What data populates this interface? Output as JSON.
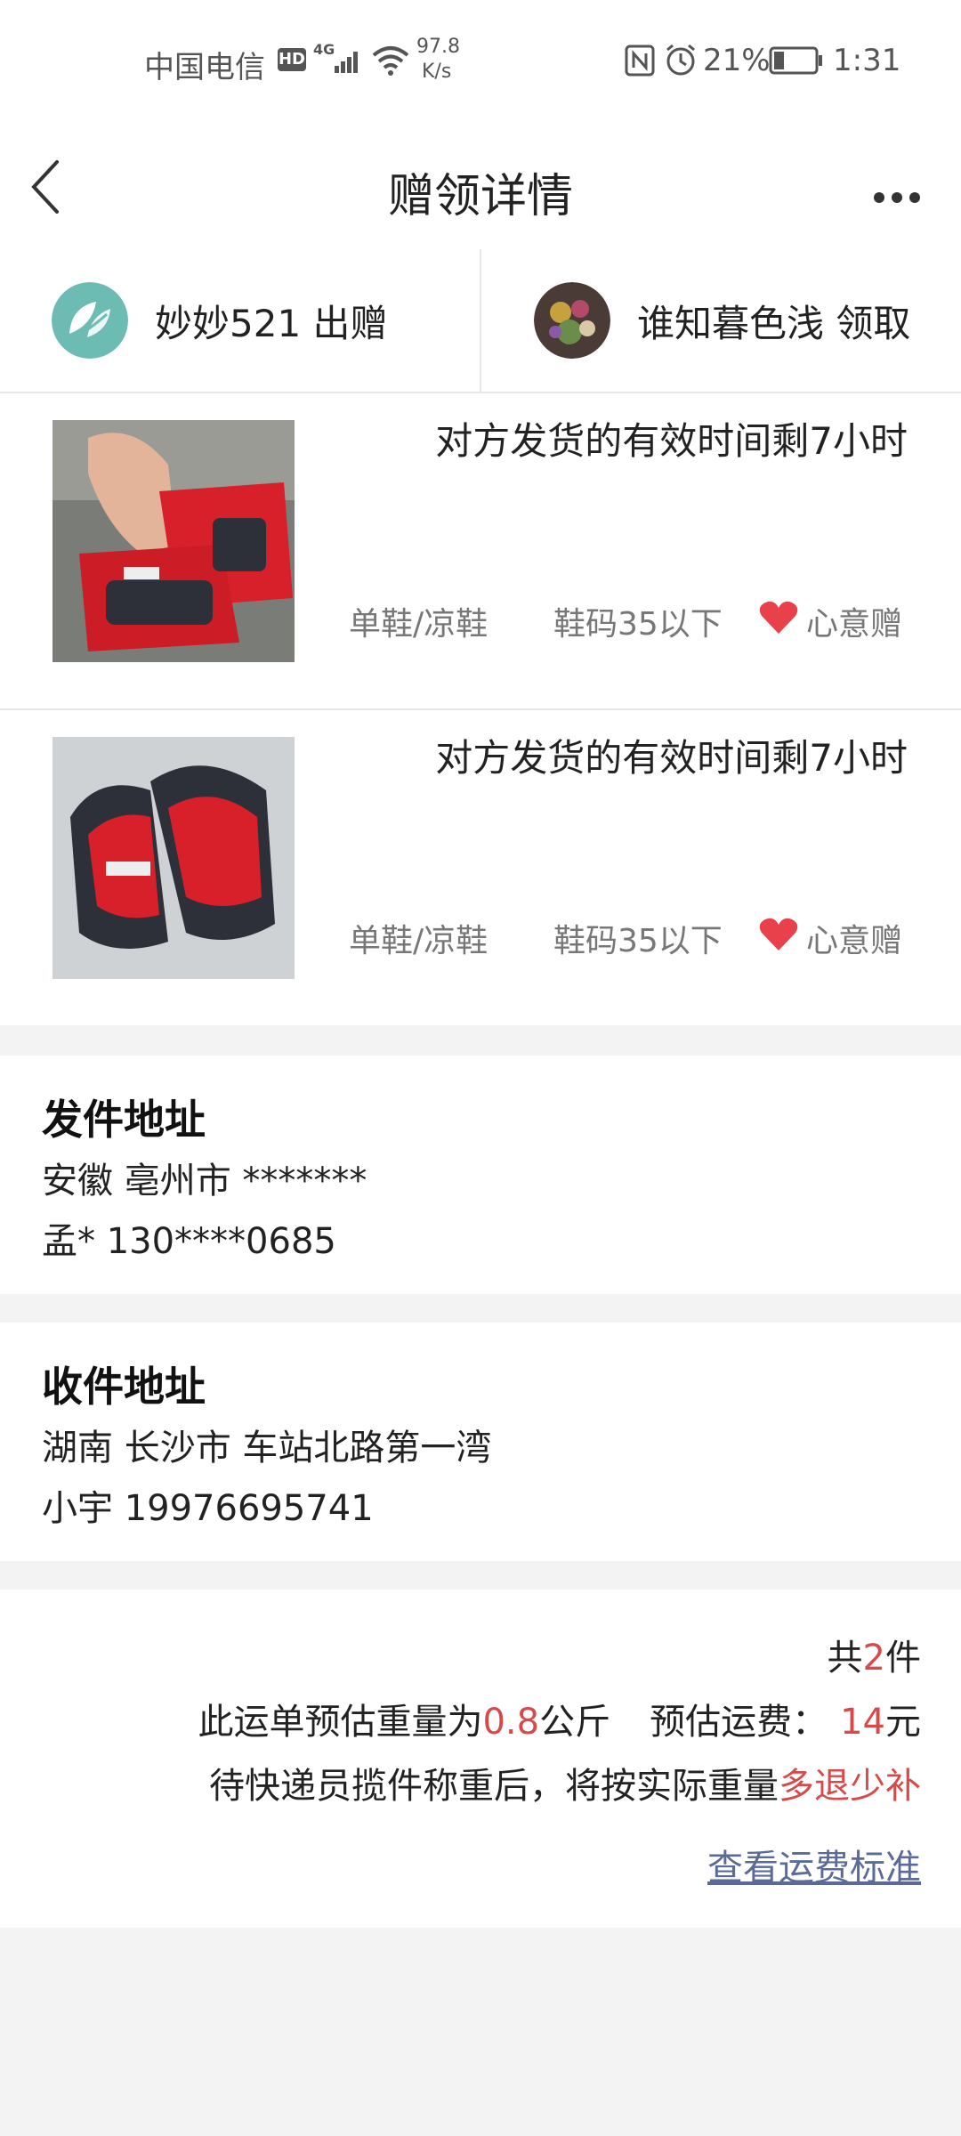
{
  "status_bar": {
    "carrier": "中国电信",
    "hd_badge": "HD",
    "network": "4G",
    "speed_value": "97.8",
    "speed_unit": "K/s",
    "battery_percent": "21%",
    "time": "1:31"
  },
  "header": {
    "title": "赠领详情"
  },
  "users": {
    "giver": {
      "name": "妙妙521",
      "action": "出赠",
      "label": "妙妙521 出赠"
    },
    "receiver": {
      "name": "谁知暮色浅",
      "action": "领取",
      "label": "谁知暮色浅 领取"
    }
  },
  "items": [
    {
      "deadline": "对方发货的有效时间剩7小时",
      "category": "单鞋/凉鞋",
      "size": "鞋码35以下",
      "tag": "心意赠"
    },
    {
      "deadline": "对方发货的有效时间剩7小时",
      "category": "单鞋/凉鞋",
      "size": "鞋码35以下",
      "tag": "心意赠"
    }
  ],
  "sender_address": {
    "title": "发件地址",
    "line1": "安徽 亳州市 *******",
    "line2": "孟* 130****0685"
  },
  "receiver_address": {
    "title": "收件地址",
    "line1": "湖南 长沙市 车站北路第一湾",
    "line2": "小宇 19976695741"
  },
  "summary": {
    "count_prefix": "共",
    "count_value": "2",
    "count_suffix": "件",
    "weight_prefix": "此运单预估重量为",
    "weight_value": "0.8",
    "weight_unit": "公斤",
    "fee_prefix": "预估运费：",
    "fee_value": "14",
    "fee_unit": "元",
    "note_prefix": "待快递员揽件称重后，将按实际重量",
    "note_highlight": "多退少补",
    "fee_standard_link": "查看运费标准"
  },
  "colors": {
    "accent_red": "#d84a4a",
    "link_blue": "#5a6b9a",
    "heart_red": "#e8414b"
  }
}
